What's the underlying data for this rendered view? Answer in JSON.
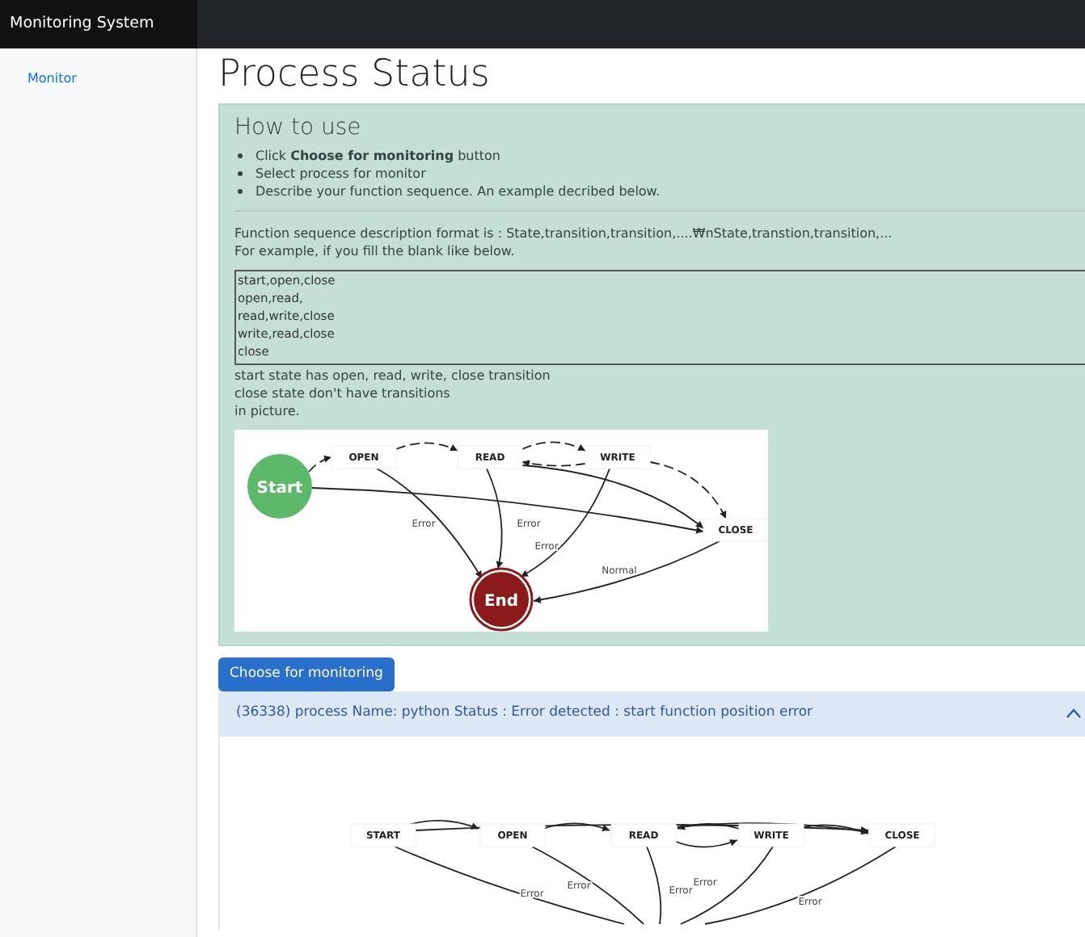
{
  "navbar": {
    "brand": "Monitoring System"
  },
  "sidebar": {
    "items": [
      {
        "label": "Monitor"
      }
    ]
  },
  "page": {
    "title": "Process Status"
  },
  "help": {
    "title": "How to use",
    "steps": [
      "Click **Choose for monitoring** button",
      "Select process for monitor",
      "Describe your function sequence. An example decribed below."
    ],
    "format_line": "Function sequence description format is : State,transition,transition,....₩nState,transtion,transition,...",
    "example_intro": "For example, if you fill the blank like below.",
    "example_value": "start,open,close\nopen,read,\nread,write,close\nwrite,read,close\nclose",
    "notes": [
      "start state has open, read, write, close transition",
      "close state don't have transitions",
      "in picture."
    ],
    "diagram": {
      "nodes": [
        {
          "kind": "start",
          "label": "Start"
        },
        {
          "kind": "state",
          "label": "OPEN"
        },
        {
          "kind": "state",
          "label": "READ"
        },
        {
          "kind": "state",
          "label": "WRITE"
        },
        {
          "kind": "state",
          "label": "CLOSE"
        },
        {
          "kind": "end",
          "label": "End"
        }
      ],
      "edge_labels": [
        "Error",
        "Error",
        "Error",
        "Normal"
      ]
    }
  },
  "choose_button": "Choose for monitoring",
  "processes": [
    {
      "header": "(36338) process Name: python Status : Error detected : start function position error",
      "expanded": true,
      "diagram": {
        "nodes": [
          {
            "kind": "state",
            "label": "START"
          },
          {
            "kind": "state",
            "label": "OPEN"
          },
          {
            "kind": "state",
            "label": "READ"
          },
          {
            "kind": "state",
            "label": "WRITE"
          },
          {
            "kind": "state",
            "label": "CLOSE"
          }
        ],
        "edge_labels": [
          "Error",
          "Error",
          "Error",
          "Error",
          "Error"
        ]
      }
    }
  ]
}
